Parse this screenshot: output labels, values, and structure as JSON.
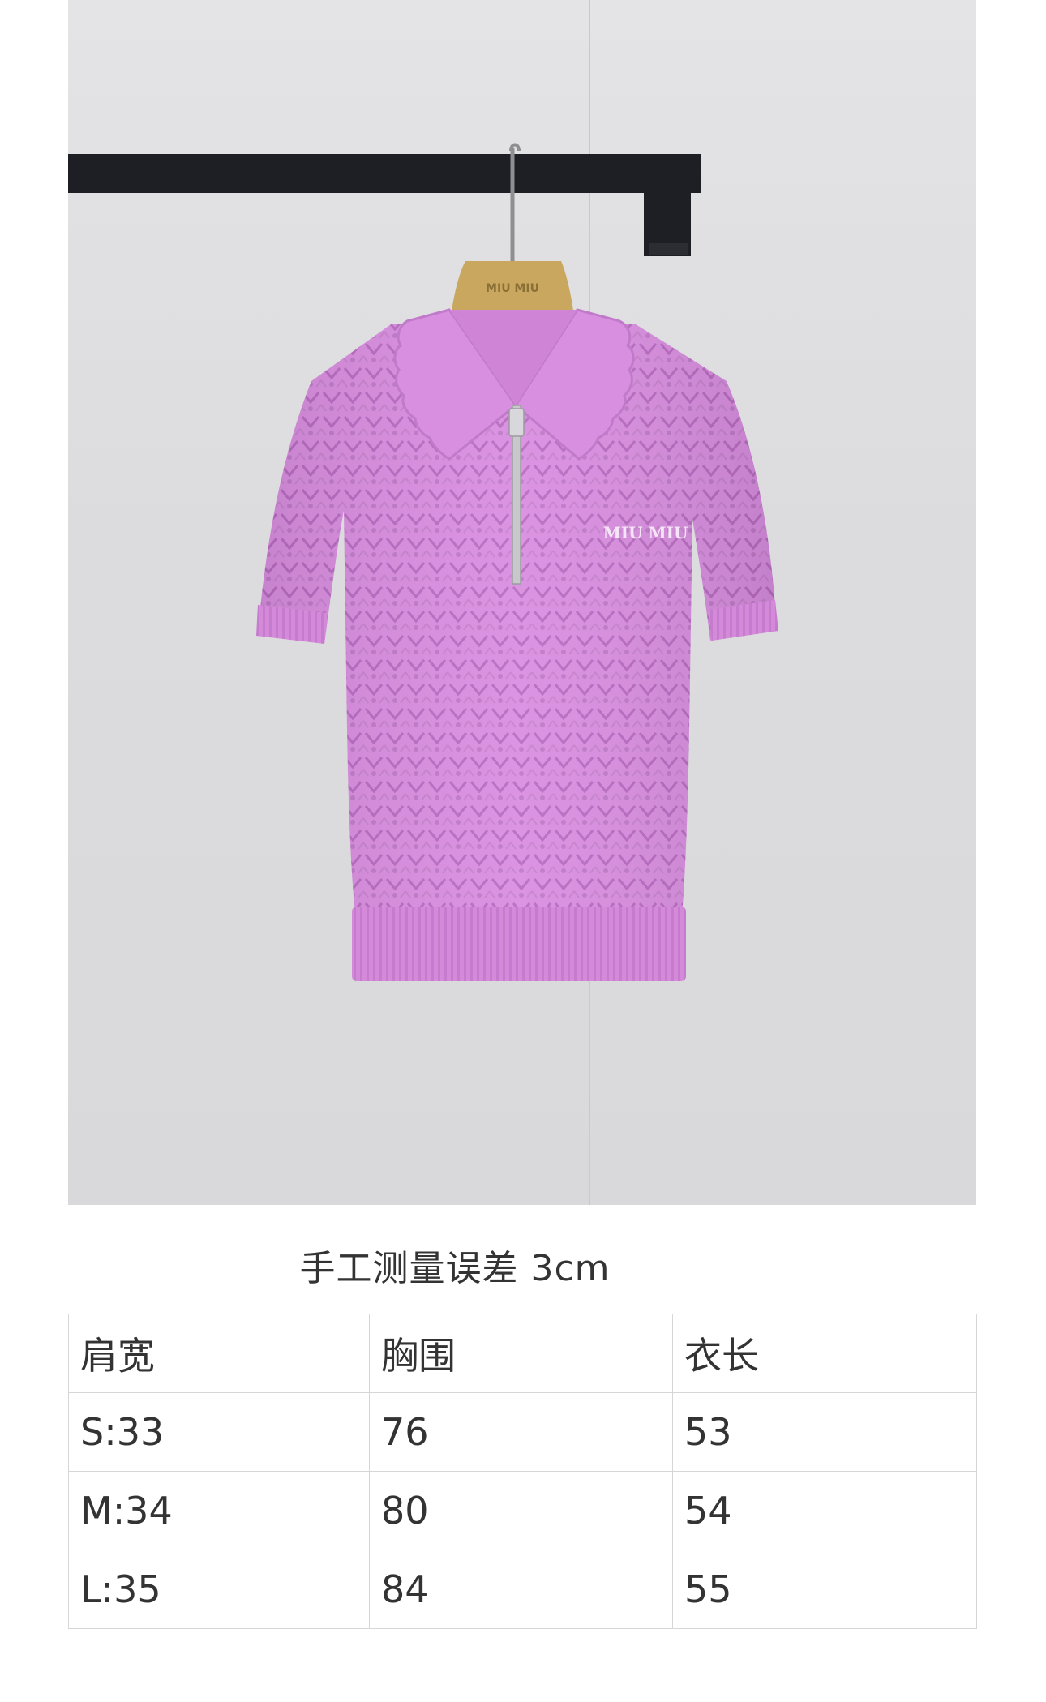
{
  "product_photo": {
    "hanger_logo": "MIU MIU",
    "chest_logo": "MIU MIU",
    "colors": {
      "garment": "#d98ee0",
      "garment_shadow": "#c778cf",
      "wall": "#dedee0",
      "rail": "#1d1f24",
      "hanger": "#c9a75e"
    }
  },
  "measurement_note": "手工测量误差 3cm",
  "size_table": {
    "headers": [
      "肩宽",
      "胸围",
      "衣长"
    ],
    "rows": [
      [
        "S:33",
        "76",
        "53"
      ],
      [
        "M:34",
        "80",
        "54"
      ],
      [
        "L:35",
        "84",
        "55"
      ]
    ]
  }
}
